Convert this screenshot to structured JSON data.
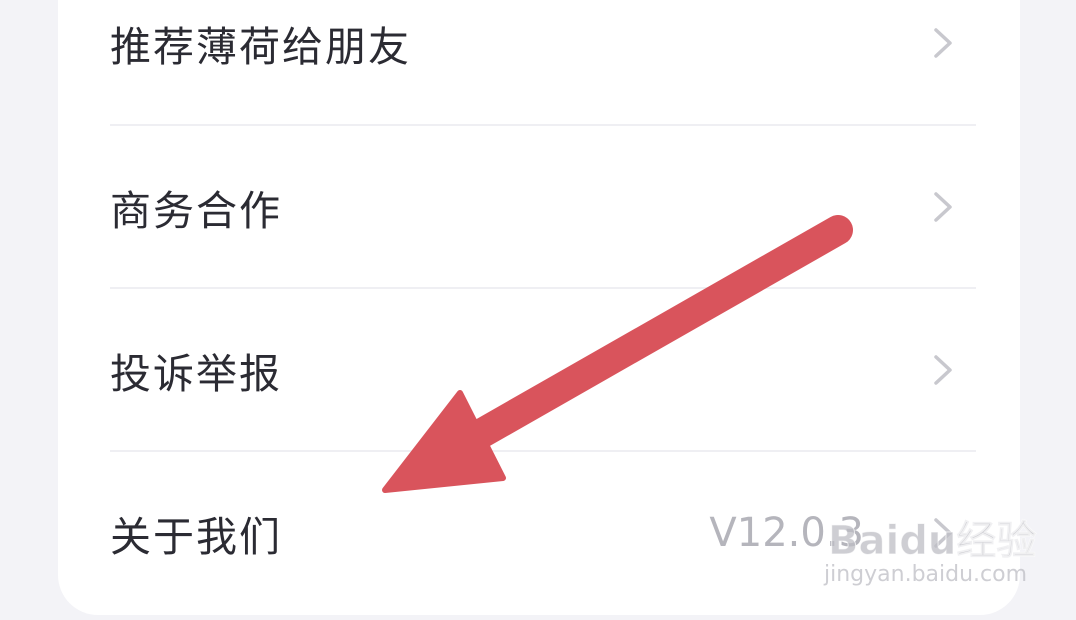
{
  "menu": {
    "items": [
      {
        "label": "推荐薄荷给朋友"
      },
      {
        "label": "商务合作"
      },
      {
        "label": "投诉举报"
      },
      {
        "label": "关于我们",
        "value": "V12.0.3"
      }
    ]
  },
  "watermark": {
    "logo": "Baidu经验",
    "url": "jingyan.baidu.com"
  },
  "colors": {
    "arrow": "#d9545c",
    "text": "#2b2b33",
    "muted": "#b5b5bc",
    "divider": "#efeff3",
    "background": "#f3f3f7"
  }
}
